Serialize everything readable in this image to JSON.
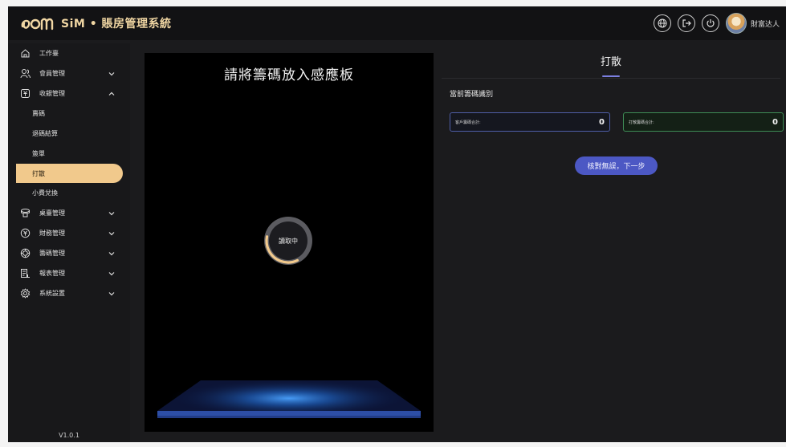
{
  "app": {
    "brand_text": "SiM • 賬房管理系統",
    "username": "財富达人",
    "version": "V1.0.1"
  },
  "sidebar": {
    "items": [
      {
        "label": "工作臺",
        "icon": "home-icon"
      },
      {
        "label": "會員管理",
        "icon": "members-icon"
      },
      {
        "label": "收銀管理",
        "icon": "cashier-icon",
        "expanded": true
      },
      {
        "label": "桌臺管理",
        "icon": "table-icon"
      },
      {
        "label": "財務管理",
        "icon": "finance-icon"
      },
      {
        "label": "籌碼管理",
        "icon": "chip-icon"
      },
      {
        "label": "報表管理",
        "icon": "report-icon"
      },
      {
        "label": "系統設置",
        "icon": "settings-icon"
      }
    ],
    "sub_items": [
      {
        "label": "賣碼"
      },
      {
        "label": "退碼結算"
      },
      {
        "label": "簽單"
      },
      {
        "label": "打散",
        "active": true
      },
      {
        "label": "小費兌換"
      }
    ]
  },
  "reader": {
    "title": "請將籌碼放入感應板",
    "status": "讀取中",
    "progress": 0.35
  },
  "panel": {
    "tab_label": "打散",
    "section_title": "當前籌碼識別",
    "client_label": "客戶籌碼合計:",
    "client_value": "0",
    "scatter_label": "打散籌碼合計:",
    "scatter_value": "0",
    "next_button": "核對無誤，下一步"
  },
  "colors": {
    "accent_gold": "#f1c98c",
    "accent_blue": "#4c58c4",
    "client_border": "#4f5ea8",
    "scatter_border": "#3e8d56"
  }
}
